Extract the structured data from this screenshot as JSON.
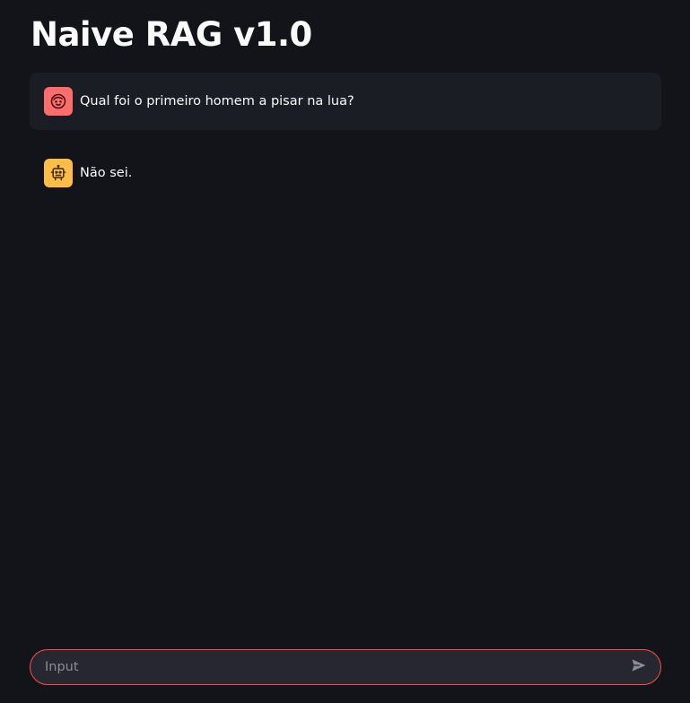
{
  "page": {
    "title": "Naive RAG v1.0"
  },
  "messages": [
    {
      "role": "user",
      "text": "Qual foi o primeiro homem a pisar na lua?",
      "avatar_icon": "user-face-icon",
      "avatar_color": "#ff6c6c"
    },
    {
      "role": "assistant",
      "text": "Não sei.",
      "avatar_icon": "robot-icon",
      "avatar_color": "#ffbd45"
    }
  ],
  "chat_input": {
    "placeholder": "Input",
    "value": "",
    "send_icon": "send-icon",
    "border_color": "#ff4b4b"
  }
}
